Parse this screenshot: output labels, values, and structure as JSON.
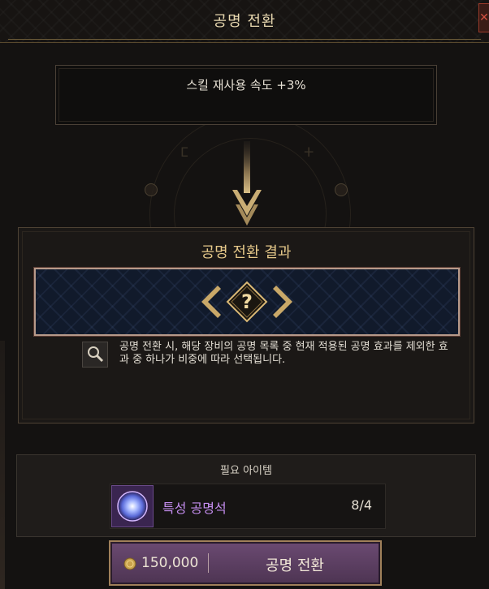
{
  "header": {
    "title": "공명 전환",
    "close_label": "✕"
  },
  "current_effect": {
    "text": "스킬 재사용 속도 +3%"
  },
  "result": {
    "title": "공명 전환 결과",
    "placeholder_icon": "question-mark-icon",
    "info_text": "공명 전환 시, 해당 장비의 공명 목록 중 현재 적용된 공명 효과를 제외한 효과 중 하나가 비중에 따라 선택됩니다.",
    "info_icon": "magnifier-icon"
  },
  "required": {
    "title": "필요 아이템",
    "item_name": "특성 공명석",
    "item_count": "8/4",
    "item_icon": "resonance-stone-icon",
    "item_name_color": "#c58ef0"
  },
  "action": {
    "cost": "150,000",
    "cost_icon": "gold-coin-icon",
    "label": "공명 전환"
  }
}
